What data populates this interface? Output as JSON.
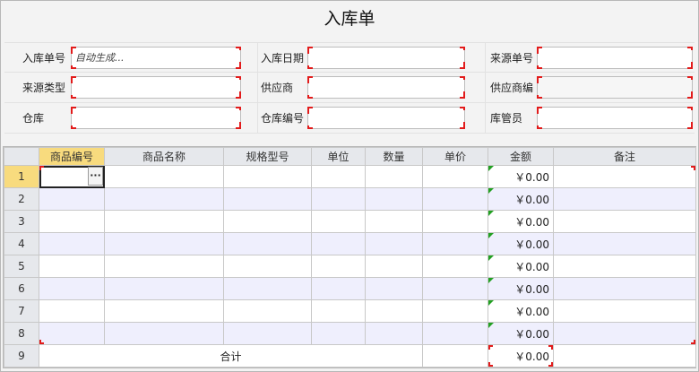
{
  "title": "入库单",
  "form": {
    "rows": [
      [
        {
          "label": "入库单号",
          "value": "自动生成..."
        },
        {
          "label": "入库日期",
          "value": ""
        },
        {
          "label": "来源单号",
          "value": ""
        }
      ],
      [
        {
          "label": "来源类型",
          "value": ""
        },
        {
          "label": "供应商",
          "value": ""
        },
        {
          "label": "供应商编",
          "value": ""
        }
      ],
      [
        {
          "label": "仓库",
          "value": ""
        },
        {
          "label": "仓库编号",
          "value": ""
        },
        {
          "label": "库管员",
          "value": ""
        }
      ]
    ]
  },
  "grid": {
    "columns": [
      "商品编号",
      "商品名称",
      "规格型号",
      "单位",
      "数量",
      "单价",
      "金额",
      "备注"
    ],
    "row_numbers": [
      "1",
      "2",
      "3",
      "4",
      "5",
      "6",
      "7",
      "8",
      "9"
    ],
    "amount_values": [
      "￥0.00",
      "￥0.00",
      "￥0.00",
      "￥0.00",
      "￥0.00",
      "￥0.00",
      "￥0.00",
      "￥0.00"
    ],
    "total_label": "合计",
    "total_amount": "￥0.00",
    "ellipsis": "···"
  },
  "colors": {
    "required_marker": "#e21b1b",
    "selected_header": "#f8db7e",
    "alt_row": "#efeffd",
    "formula_marker": "#22a022"
  }
}
